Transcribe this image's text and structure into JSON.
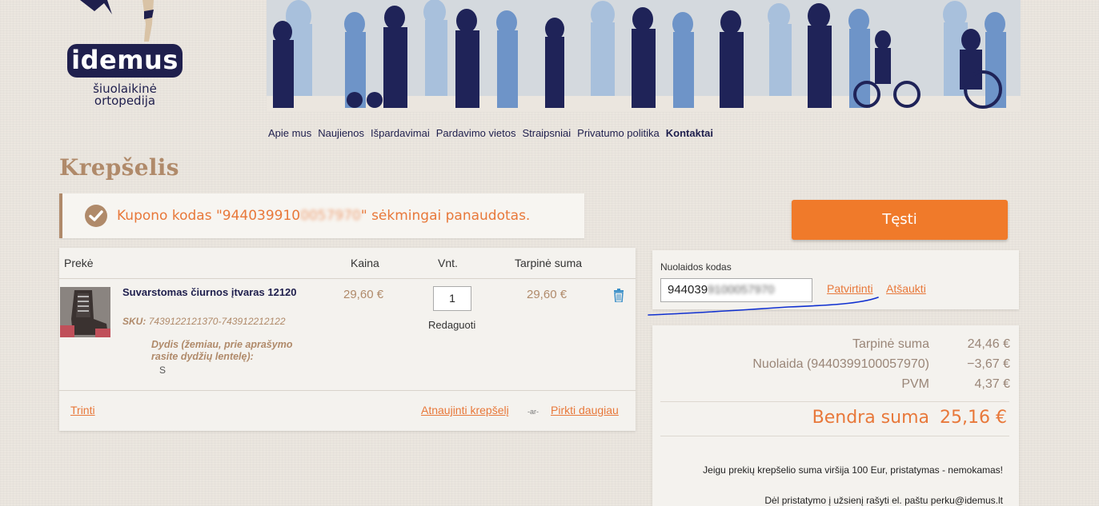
{
  "logo": {
    "name": "idemus",
    "tagline_line1": "šiuolaikinė",
    "tagline_line2": "ortopedija"
  },
  "nav": {
    "items": [
      "Apie mus",
      "Naujienos",
      "Išpardavimai",
      "Pardavimo vietos",
      "Straipsniai",
      "Privatumo politika",
      "Kontaktai"
    ],
    "active": "Kontaktai"
  },
  "page_title": "Krepšelis",
  "message": {
    "prefix": "Kupono kodas \"944039910",
    "code_hidden": "0057970",
    "suffix": "\" sėkmingai panaudotas."
  },
  "cart": {
    "headers": {
      "product": "Prekė",
      "price": "Kaina",
      "qty": "Vnt.",
      "subtotal": "Tarpinė suma"
    },
    "item": {
      "name": "Suvarstomas čiurnos įtvaras 12120",
      "sku_label": "SKU:",
      "sku": "7439122121370-743912212122",
      "option_label": "Dydis (žemiau, prie aprašymo rasite dydžių lentelę):",
      "option_value": "S",
      "price": "29,60 €",
      "qty": "1",
      "edit": "Redaguoti",
      "subtotal": "29,60 €"
    },
    "delete_link": "Trinti",
    "update_link": "Atnaujinti krepšelį",
    "or": "-ar-",
    "continue_shopping": "Pirkti daugiau"
  },
  "continue_button": "Tęsti",
  "discount": {
    "label": "Nuolaidos kodas",
    "value_visible": "944039",
    "value_hidden": "9100057970",
    "confirm": "Patvirtinti",
    "cancel": "Atšaukti"
  },
  "totals": {
    "subtotal_label": "Tarpinė suma",
    "subtotal": "24,46 €",
    "discount_label": "Nuolaida (9440399100057970)",
    "discount": "−3,67 €",
    "vat_label": "PVM",
    "vat": "4,37 €",
    "grand_label": "Bendra suma",
    "grand": "25,16 €",
    "note1": "Jeigu prekių krepšelio suma viršija 100 Eur, pristatymas - nemokamas!",
    "note2": "Dėl pristatymo į užsienį rašyti el. paštu perku@idemus.lt"
  },
  "colors": {
    "accent": "#e8783a",
    "brand_dark": "#1f1f4d",
    "brown": "#b08a6a",
    "button": "#f07a2a",
    "annotation": "#1030d0"
  }
}
